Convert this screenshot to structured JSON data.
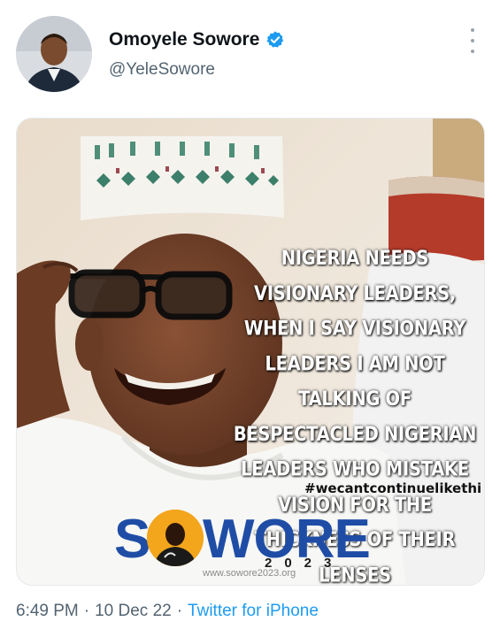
{
  "author": {
    "display_name": "Omoyele Sowore",
    "handle": "@YeleSowore",
    "verified_icon": "verified-badge-icon",
    "avatar_icon": "avatar"
  },
  "media": {
    "overlay_text": "NIGERIA NEEDS VISIONARY LEADERS, WHEN I SAY VISIONARY LEADERS I AM NOT TALKING OF BESPECTACLED NIGERIAN LEADERS WHO MISTAKE VISION FOR THE THICKNESS OF THEIR LENSES",
    "hashtag": "#wecantcontinuelikethi",
    "logo_s": "S",
    "logo_wore": "WORE",
    "logo_year": "2023",
    "logo_url": "www.sowore2023.org"
  },
  "meta": {
    "time": "6:49 PM",
    "date": "10 Dec 22",
    "separator": "·",
    "source": "Twitter for iPhone"
  },
  "colors": {
    "verified": "#1d9bf0",
    "link": "#1d9bf0",
    "secondary_text": "#536471",
    "logo_blue": "#1f4da6",
    "logo_orange": "#f3a51c"
  }
}
